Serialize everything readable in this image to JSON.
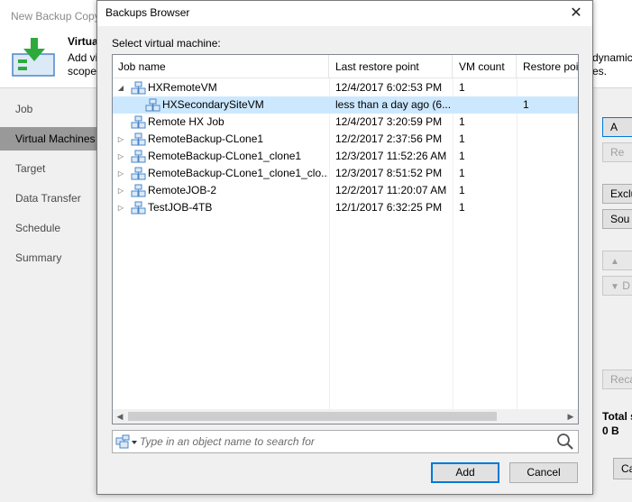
{
  "wizard": {
    "title": "New Backup Copy",
    "header_title": "Virtua",
    "header_desc_line1": "Add vi",
    "header_desc_line2": "scope.",
    "header_right_line1": "dynamic",
    "header_right_line2": "es.",
    "nav_items": [
      "Job",
      "Virtual Machines",
      "Target",
      "Data Transfer",
      "Schedule",
      "Summary"
    ],
    "active_nav": "Virtual Machines",
    "side_buttons": [
      "A",
      "Re",
      "Exclu",
      "Sou",
      "D",
      "Reca"
    ],
    "total_label": "Total s",
    "total_value": "0 B",
    "cancel_fragment": "Ca"
  },
  "dialog": {
    "title": "Backups Browser",
    "close_glyph": "✕",
    "select_label": "Select virtual machine:",
    "columns": [
      "Job name",
      "Last restore point",
      "VM count",
      "Restore poi"
    ],
    "rows": [
      {
        "name": "HXRemoteVM",
        "last_restore": "12/4/2017 6:02:53 PM",
        "vm_count": "1",
        "restore_points": "",
        "level": 0,
        "expander": "expanded",
        "selected": false
      },
      {
        "name": "HXSecondarySiteVM",
        "last_restore": "less than a day ago (6...",
        "vm_count": "",
        "restore_points": "1",
        "level": 1,
        "expander": "none",
        "selected": true
      },
      {
        "name": "Remote HX Job",
        "last_restore": "12/4/2017 3:20:59 PM",
        "vm_count": "1",
        "restore_points": "",
        "level": 0,
        "expander": "none",
        "selected": false
      },
      {
        "name": "RemoteBackup-CLone1",
        "last_restore": "12/2/2017 2:37:56 PM",
        "vm_count": "1",
        "restore_points": "",
        "level": 0,
        "expander": "collapsed",
        "selected": false
      },
      {
        "name": "RemoteBackup-CLone1_clone1",
        "last_restore": "12/3/2017 11:52:26 AM",
        "vm_count": "1",
        "restore_points": "",
        "level": 0,
        "expander": "collapsed",
        "selected": false
      },
      {
        "name": "RemoteBackup-CLone1_clone1_clo...",
        "last_restore": "12/3/2017 8:51:52 PM",
        "vm_count": "1",
        "restore_points": "",
        "level": 0,
        "expander": "collapsed",
        "selected": false
      },
      {
        "name": "RemoteJOB-2",
        "last_restore": "12/2/2017 11:20:07 AM",
        "vm_count": "1",
        "restore_points": "",
        "level": 0,
        "expander": "collapsed",
        "selected": false
      },
      {
        "name": "TestJOB-4TB",
        "last_restore": "12/1/2017 6:32:25 PM",
        "vm_count": "1",
        "restore_points": "",
        "level": 0,
        "expander": "collapsed",
        "selected": false
      }
    ],
    "search_placeholder": "Type in an object name to search for",
    "search_value": "",
    "add_label": "Add",
    "cancel_label": "Cancel"
  },
  "icons": {
    "wizard_header": "download-vm-icon",
    "row": "vm-group-icon",
    "search": "magnifier-icon",
    "scope": "vm-scope-dropdown-icon"
  },
  "colors": {
    "selection": "#cce8ff",
    "accent": "#0078d7",
    "nav_active": "#999999",
    "icon_blue": "#4a86c8",
    "icon_green": "#2eaa3c"
  }
}
